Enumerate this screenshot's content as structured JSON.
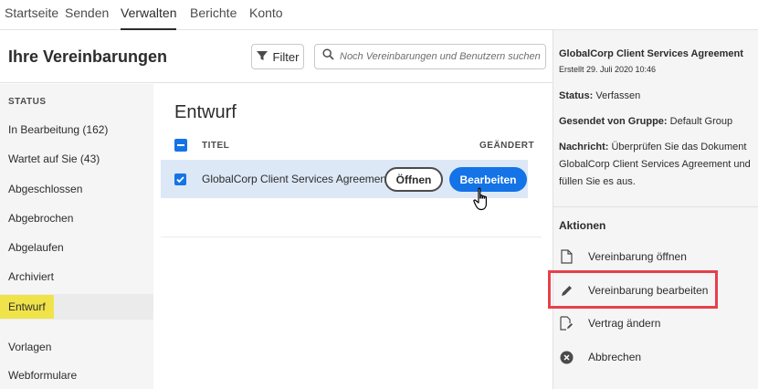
{
  "nav": {
    "tabs": [
      {
        "label": "Startseite"
      },
      {
        "label": "Senden"
      },
      {
        "label": "Verwalten"
      },
      {
        "label": "Berichte"
      },
      {
        "label": "Konto"
      }
    ]
  },
  "header": {
    "title": "Ihre Vereinbarungen",
    "filter_label": "Filter",
    "search_placeholder": "Noch Vereinbarungen und Benutzern suchen..."
  },
  "sidebar": {
    "section": "STATUS",
    "items": [
      {
        "label": "In Bearbeitung (162)"
      },
      {
        "label": "Wartet auf Sie (43)"
      },
      {
        "label": "Abgeschlossen"
      },
      {
        "label": "Abgebrochen"
      },
      {
        "label": "Abgelaufen"
      },
      {
        "label": "Archiviert"
      },
      {
        "label": "Entwurf"
      },
      {
        "label": "Vorlagen"
      },
      {
        "label": "Webformulare"
      }
    ],
    "selected": "Entwurf"
  },
  "main": {
    "heading": "Entwurf",
    "columns": {
      "title": "TITEL",
      "changed": "GEÄNDERT"
    },
    "rows": [
      {
        "name": "GlobalCorp Client Services Agreement",
        "open_label": "Öffnen",
        "edit_label": "Bearbeiten"
      }
    ]
  },
  "details": {
    "title": "GlobalCorp Client Services Agreement",
    "created": "Erstellt 29. Juli 2020 10:46",
    "status_key": "Status:",
    "status_value": "Verfassen",
    "group_key": "Gesendet von Gruppe:",
    "group_value": "Default Group",
    "message_key": "Nachricht:",
    "message_value": "Überprüfen Sie das Dokument GlobalCorp Client Services Agreement und füllen Sie es aus.",
    "actions_heading": "Aktionen",
    "actions": [
      {
        "label": "Vereinbarung öffnen",
        "icon": "document-icon"
      },
      {
        "label": "Vereinbarung bearbeiten",
        "icon": "pencil-icon"
      },
      {
        "label": "Vertrag ändern",
        "icon": "document-edit-icon"
      },
      {
        "label": "Abbrechen",
        "icon": "cancel-circle-icon"
      }
    ]
  },
  "colors": {
    "accent": "#1473e6",
    "selected_highlight": "#f0e34a",
    "row_highlight": "#dde8f7",
    "callout": "#e6404a"
  }
}
